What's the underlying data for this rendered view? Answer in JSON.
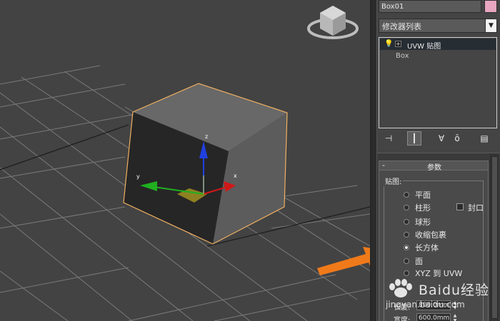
{
  "viewport": {
    "axis_labels": {
      "x": "x",
      "y": "y",
      "z": "z"
    }
  },
  "panel": {
    "object_name": "Box01",
    "object_color": "#e7a5c0",
    "modifier_list_label": "修改器列表",
    "stack": [
      {
        "label": "UVW 贴图",
        "selected": true
      },
      {
        "label": "Box",
        "selected": false
      }
    ],
    "toolbar_icons": [
      "pin-stack-icon",
      "show-end-result-icon",
      "make-unique-icon",
      "remove-modifier-icon",
      "configure-modifier-sets-icon"
    ],
    "rollout": {
      "collapse_sign": "-",
      "title": "参数",
      "group_title": "贴图:",
      "mapping_options": [
        {
          "label": "平面",
          "selected": false
        },
        {
          "label": "柱形",
          "selected": false
        },
        {
          "label": "球形",
          "selected": false
        },
        {
          "label": "收缩包裹",
          "selected": false
        },
        {
          "label": "长方体",
          "selected": true
        },
        {
          "label": "面",
          "selected": false
        },
        {
          "label": "XYZ 到 UVW",
          "selected": false
        }
      ],
      "cap_label": "封口",
      "cap_checked": false,
      "fields": [
        {
          "label": "长度:",
          "value": "800.0mm"
        },
        {
          "label": "宽度:",
          "value": "600.0mm"
        }
      ]
    }
  },
  "watermark": {
    "title": "Baidu经验",
    "subtitle": "jingyan.baidu.com"
  },
  "colors": {
    "annotation_arrow": "#f07a1a",
    "gizmo_x": "#d01818",
    "gizmo_y": "#20b020",
    "gizmo_z": "#2040e0",
    "selection_edge": "#f0b060"
  }
}
